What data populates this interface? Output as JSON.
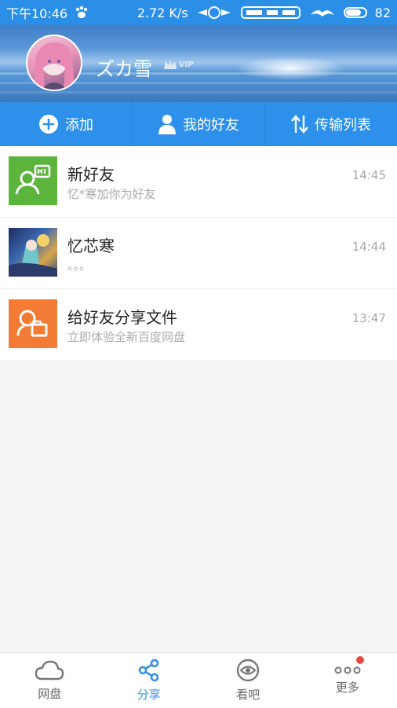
{
  "status_bar": {
    "time": "下午10:46",
    "net_speed": "2.72 K/s",
    "battery": "82",
    "battery_level": 0.82,
    "icons": [
      "paw-icon",
      "clock-deco-icon",
      "carrier-logo-icon",
      "wing-deco-icon",
      "battery-icon"
    ]
  },
  "profile": {
    "username": "ズカ雪",
    "vip_label": "VIP"
  },
  "actions": [
    {
      "label": "添加",
      "icon": "plus-circle-icon"
    },
    {
      "label": "我的好友",
      "icon": "person-icon"
    },
    {
      "label": "传输列表",
      "icon": "transfer-arrows-icon"
    }
  ],
  "items": [
    {
      "title": "新好友",
      "subtitle": "忆*寒加你为好友",
      "time": "14:45",
      "icon": "new-friend-icon",
      "color": "#5db43d"
    },
    {
      "title": "忆芯寒",
      "subtitle": "。。。",
      "time": "14:44",
      "icon": "anime-avatar-icon",
      "color": "#3c5a8a"
    },
    {
      "title": "给好友分享文件",
      "subtitle": "立即体验全新百度网盘",
      "time": "13:47",
      "icon": "share-file-icon",
      "color": "#f27b35"
    }
  ],
  "nav": [
    {
      "label": "网盘",
      "icon": "cloud-icon",
      "active": false
    },
    {
      "label": "分享",
      "icon": "share-icon",
      "active": true
    },
    {
      "label": "看吧",
      "icon": "eye-icon",
      "active": false
    },
    {
      "label": "更多",
      "icon": "more-dots-icon",
      "active": false,
      "badge": true
    }
  ],
  "colors": {
    "accent": "#2d90ea",
    "status_bar": "#2b8fe8",
    "active_tab": "#3a8fe3",
    "badge": "#e94b45"
  }
}
